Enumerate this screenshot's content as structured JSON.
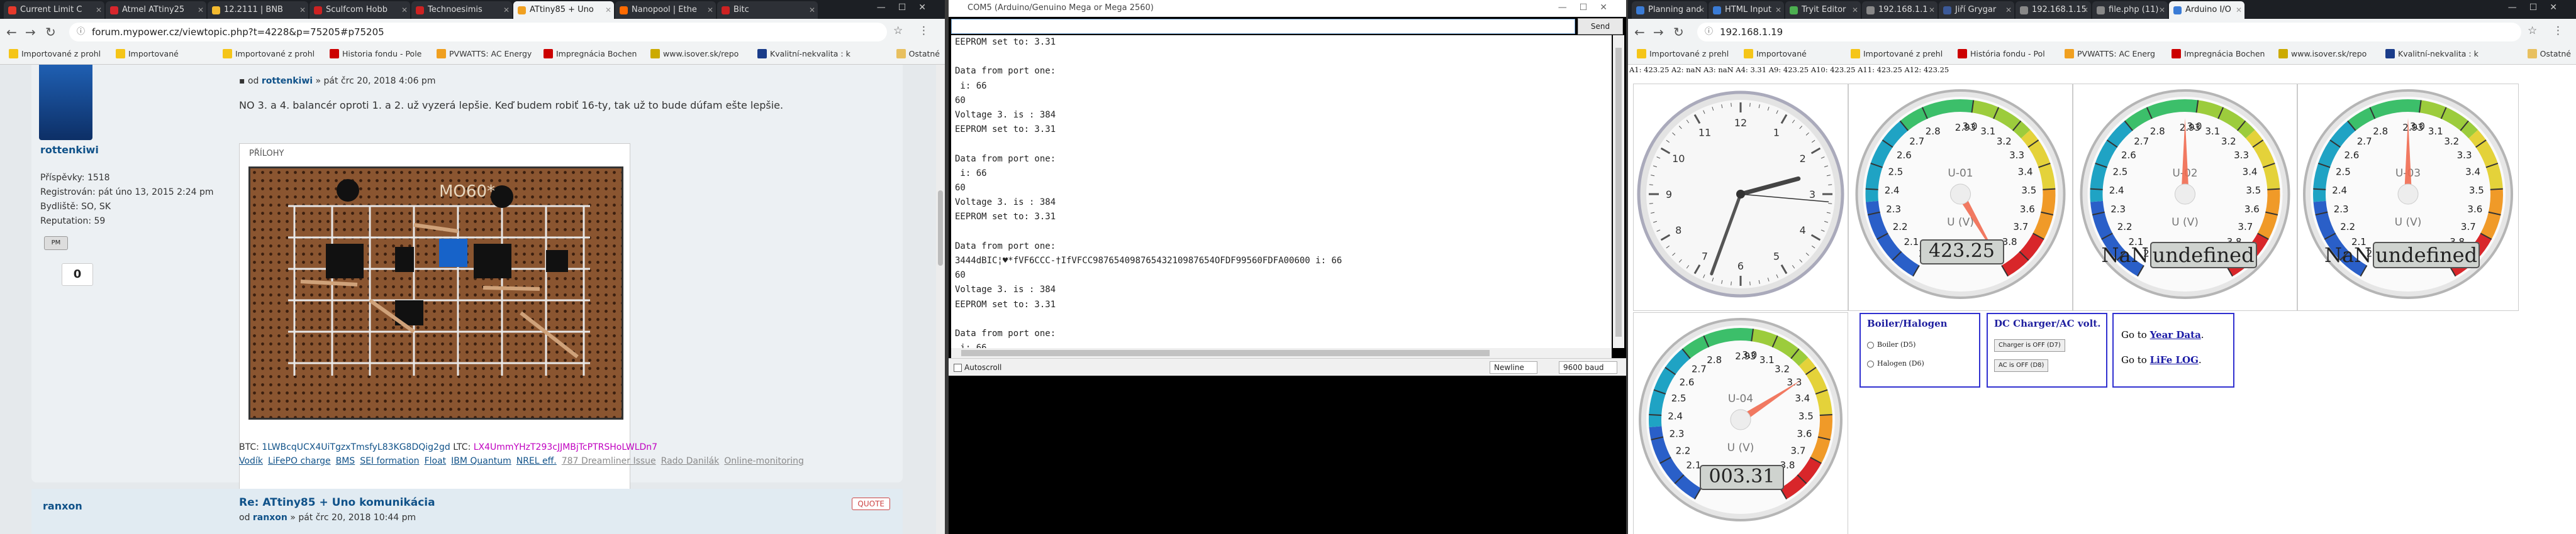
{
  "browser1": {
    "tabs": [
      {
        "label": "Current Limit C",
        "color": "#e6392b"
      },
      {
        "label": "Atmel ATtiny25",
        "color": "#d7262c"
      },
      {
        "label": "12.2111 | BNB",
        "color": "#f3ba2f"
      },
      {
        "label": "Sculfcom Hobb",
        "color": "#cc2222"
      },
      {
        "label": "Technoesimis",
        "color": "#cc2222"
      },
      {
        "label": "ATtiny85 + Uno",
        "color": "#f0a020"
      },
      {
        "label": "Nanopool | Ethe",
        "color": "#ff6a00"
      },
      {
        "label": "Bitc",
        "color": "#cc2222"
      }
    ],
    "url": "forum.mypower.cz/viewtopic.php?t=4228&p=75205#p75205",
    "bookmarks": [
      {
        "label": "Importované z prohl",
        "color": "#f5c518"
      },
      {
        "label": "Importované",
        "color": "#f5c518"
      },
      {
        "label": "Importované z prohl",
        "color": "#f5c518"
      },
      {
        "label": "Historia fondu - Pole",
        "color": "#c00"
      },
      {
        "label": "PVWATTS: AC Energy",
        "color": "#f0a020"
      },
      {
        "label": "Impregnácia Bochen",
        "color": "#c00"
      },
      {
        "label": "www.isover.sk/repo",
        "color": "#ccaa00"
      },
      {
        "label": "Kvalitní-nekvalita : k",
        "color": "#1a3c8a"
      }
    ],
    "bookmark_other": "Ostatné",
    "post": {
      "author": "rottenkiwi",
      "info": [
        "Příspěvky: 1518",
        "Registrován: pát úno 13, 2015 2:24 pm",
        "Bydliště: SO, SK",
        "Reputation: 59"
      ],
      "pm": "PM",
      "karma": "0",
      "meta_by": "od",
      "meta_author": "rottenkiwi",
      "meta_date": "» pát črc 20, 2018 4:06 pm",
      "text": "NO 3. a 4. balancér oproti 1. a 2. už vyzerá lepšie. Keď budem robiť 16-ty, tak už to bude dúfam ešte lepšie.",
      "attach_title": "PŘÍLOHY",
      "sig_btc": "BTC:",
      "sig_btc_addr": "1LWBcqUCX4UiTgzxTmsfyL83KG8DQig2gd",
      "sig_ltc": "LTC:",
      "sig_ltc_addr": "LX4UmmYHzT293cJJMBjTcPTRSHoLWLDn7",
      "sig_links": [
        "Vodík",
        "LiFePO charge",
        "BMS",
        "SEI formation",
        "Float",
        "IBM Quantum",
        "NREL eff."
      ],
      "sig_links_gray": [
        "787 Dreamliner Issue",
        "Rado Danilák",
        "Online-monitoring"
      ]
    },
    "post2": {
      "author": "ranxon",
      "title": "Re: ATtiny85 + Uno komunikácia",
      "meta_by": "od",
      "meta_author": "ranxon",
      "meta_date": "» pát črc 20, 2018 10:44 pm",
      "quote": "QUOTE"
    }
  },
  "serial": {
    "title": "COM5 (Arduino/Genuino Mega or Mega 2560)",
    "send": "Send",
    "lines": "EEPROM set to: 3.31\n\nData from port one:\n i: 66\n60\nVoltage 3. is : 384\nEEPROM set to: 3.31\n\nData from port one:\n i: 66\n60\nVoltage 3. is : 384\nEEPROM set to: 3.31\n\nData from port one:\n3444dBIC¦♥*fVF6CCC-†IfVFCC98765409876543210987654OFDF99560FDFA00600 i: 66\n60\nVoltage 3. is : 384\nEEPROM set to: 3.31\n\nData from port one:\n i: 66\n60\nVoltage 3. is : 384\nEEPROM set to: 3.31\n\nData from port one:",
    "autoscroll": "Autoscroll",
    "newline": "Newline",
    "baud": "9600 baud"
  },
  "browser2": {
    "tabs": [
      {
        "label": "Planning and",
        "color": "#3a7bd5"
      },
      {
        "label": "HTML Input",
        "color": "#3a7bd5"
      },
      {
        "label": "Tryit Editor",
        "color": "#4caf50"
      },
      {
        "label": "192.168.1.1",
        "color": "#888"
      },
      {
        "label": "Jiří Grygar",
        "color": "#3b5998"
      },
      {
        "label": "192.168.1.15",
        "color": "#888"
      },
      {
        "label": "file.php (11)",
        "color": "#888"
      },
      {
        "label": "Arduino I/O",
        "color": "#3a7bd5"
      }
    ],
    "url": "192.168.1.19",
    "bookmarks": [
      {
        "label": "Importované z prehl",
        "color": "#f5c518"
      },
      {
        "label": "Importované",
        "color": "#f5c518"
      },
      {
        "label": "Importované z prehl",
        "color": "#f5c518"
      },
      {
        "label": "História fondu - Pol",
        "color": "#c00"
      },
      {
        "label": "PVWATTS: AC Energ",
        "color": "#f0a020"
      },
      {
        "label": "Impregnácia Bochen",
        "color": "#c00"
      },
      {
        "label": "www.isover.sk/repo",
        "color": "#ccaa00"
      },
      {
        "label": "Kvalitní-nekvalita : k",
        "color": "#1a3c8a"
      }
    ],
    "bookmark_other": "Ostatné",
    "topline": "A1: 423.25 A2: naN A3: naN A4: 3.31 A9: 423.25 A10: 423.25 A11: 423.25 A12: 423.25",
    "gauges": [
      {
        "id": "U-01",
        "unit": "U (V)",
        "top": "2.93",
        "display": "423.25",
        "value": 4.0,
        "nan": false
      },
      {
        "id": "U-02",
        "unit": "U (V)",
        "top": "2.93",
        "display_a": "NaN",
        "display_b": "undefined",
        "value": 2.95,
        "nan": true
      },
      {
        "id": "U-03",
        "unit": "U (V)",
        "top": "2.93",
        "display_a": "NaN",
        "display_b": "undefined",
        "value": 2.95,
        "nan": true
      },
      {
        "id": "U-04",
        "unit": "U (V)",
        "top": "2.93",
        "display": "003.31",
        "value": 3.31,
        "nan": false
      }
    ],
    "scale_labels": [
      "2.0",
      "2.1",
      "2.2",
      "2.3",
      "2.4",
      "2.5",
      "2.6",
      "2.7",
      "2.8",
      "3.0",
      "3.1",
      "3.2",
      "3.3",
      "3.4",
      "3.5",
      "3.6",
      "3.7",
      "3.8",
      "3.9"
    ],
    "clock_numbers": [
      "12",
      "1",
      "2",
      "3",
      "4",
      "5",
      "6",
      "7",
      "8",
      "9",
      "10",
      "11"
    ],
    "boiler": {
      "title": "Boiler/Halogen",
      "opt1": "Boiler (D5)",
      "opt2": "Halogen (D6)"
    },
    "charger": {
      "title": "DC Charger/AC volt.",
      "btn1": "Charger is OFF (D7)",
      "btn2": "AC is OFF (D8)"
    },
    "links": {
      "goto": "Go to",
      "year": "Year Data",
      "life": "LiFe LOG"
    }
  }
}
